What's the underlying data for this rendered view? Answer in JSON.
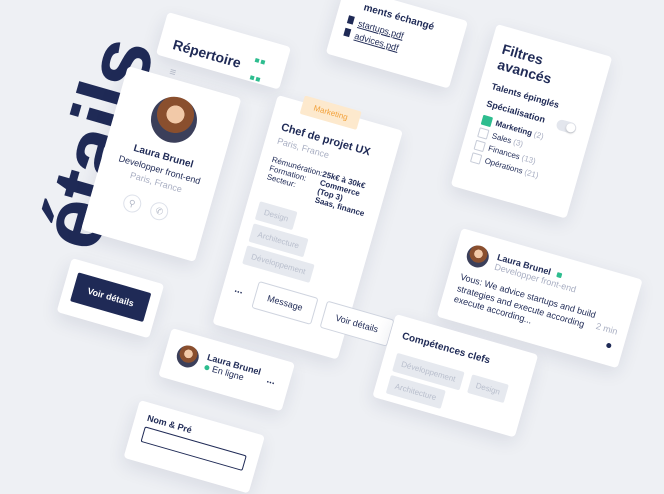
{
  "hero": {
    "word": "étails"
  },
  "docs": {
    "title": "ments échangé",
    "files": [
      "startups.pdf",
      "advices.pdf"
    ]
  },
  "directory": {
    "title": "Répertoire"
  },
  "profile": {
    "name": "Laura Brunel",
    "role": "Developper front-end",
    "location": "Paris, France"
  },
  "job": {
    "tag": "Marketing",
    "title": "Chef de projet UX",
    "location": "Paris, France",
    "labels": [
      "Rémunération:",
      "Formation:",
      "Secteur:"
    ],
    "values": [
      "25k€ à 30k€",
      "Commerce (Top 3)",
      "Saas, finance"
    ],
    "chips": [
      "Design",
      "Architecture",
      "Développement"
    ],
    "more": "...",
    "message_btn": "Message",
    "details_btn": "Voir détails"
  },
  "filters": {
    "title": "Filtres avancés",
    "pinned": "Talents épinglés",
    "specialisation": "Spécialisation",
    "options": [
      {
        "label": "Marketing",
        "count": "(2)",
        "checked": true
      },
      {
        "label": "Sales",
        "count": "(3)",
        "checked": false
      },
      {
        "label": "Finances",
        "count": "(13)",
        "checked": false
      },
      {
        "label": "Opérations",
        "count": "(21)",
        "checked": false
      }
    ]
  },
  "message_card": {
    "name": "Laura Brunel",
    "role": "Developper front-end",
    "time": "2 min",
    "text": "Vous: We advice startups and build strategies and execute according execute according..."
  },
  "voir_btn": "Voir détails",
  "online_card": {
    "name": "Laura Brunel",
    "status": "En ligne",
    "more": "..."
  },
  "skills": {
    "title": "Compétences clefs",
    "chips": [
      "Développement",
      "Design",
      "Architecture"
    ]
  },
  "form": {
    "label": "Nom & Pré"
  },
  "colors": {
    "navy": "#1f2a56",
    "green": "#2ebd8f",
    "orange": "#f2a13a"
  }
}
